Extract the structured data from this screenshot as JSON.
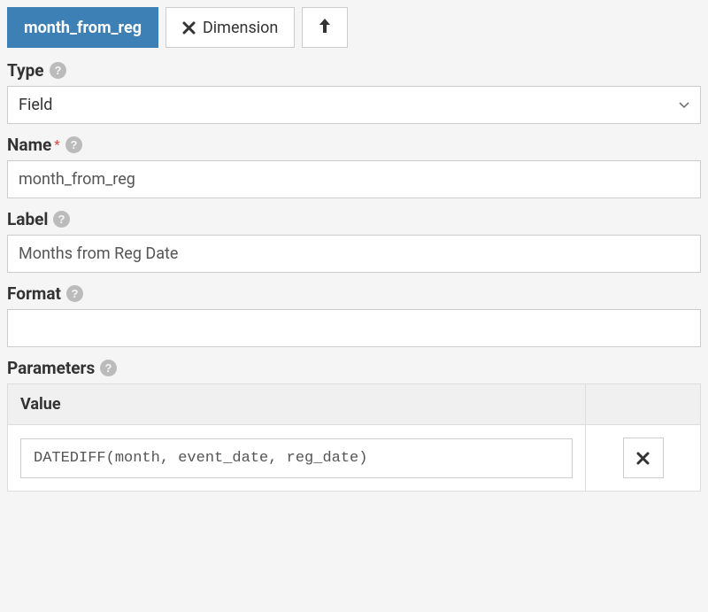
{
  "tabs": {
    "main": "month_from_reg",
    "dimension": "Dimension"
  },
  "fields": {
    "type": {
      "label": "Type",
      "value": "Field"
    },
    "name": {
      "label": "Name",
      "value": "month_from_reg"
    },
    "label_field": {
      "label": "Label",
      "value": "Months from Reg Date"
    },
    "format": {
      "label": "Format",
      "value": ""
    }
  },
  "parameters": {
    "heading": "Parameters",
    "column_header": "Value",
    "rows": [
      {
        "value": "DATEDIFF(month, event_date, reg_date)"
      }
    ]
  }
}
